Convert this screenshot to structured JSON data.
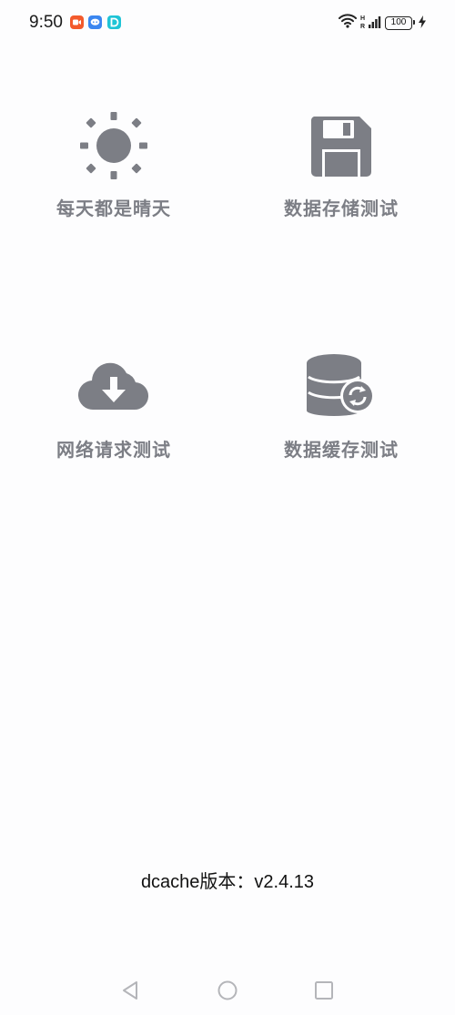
{
  "status_bar": {
    "time": "9:50",
    "notifications": [
      {
        "icon": "video-app-icon",
        "color": "#f35a2c"
      },
      {
        "icon": "chat-app-icon",
        "color": "#3a86f0"
      },
      {
        "icon": "d-app-icon",
        "color": "#1fc4d6"
      }
    ],
    "network_labels": {
      "top": "H",
      "bottom": "R"
    },
    "battery": "100",
    "charging_icon": "bolt-icon"
  },
  "features": [
    {
      "icon": "sun-icon",
      "label": "每天都是晴天"
    },
    {
      "icon": "floppy-disk-icon",
      "label": "数据存储测试"
    },
    {
      "icon": "cloud-download-icon",
      "label": "网络请求测试"
    },
    {
      "icon": "database-sync-icon",
      "label": "数据缓存测试"
    }
  ],
  "version_text": "dcache版本：v2.4.13",
  "navigation": {
    "back": "back-triangle-icon",
    "home": "home-circle-icon",
    "recents": "recents-square-icon"
  },
  "colors": {
    "icon_gray": "#7c7e85",
    "background": "#fdfdfe"
  }
}
